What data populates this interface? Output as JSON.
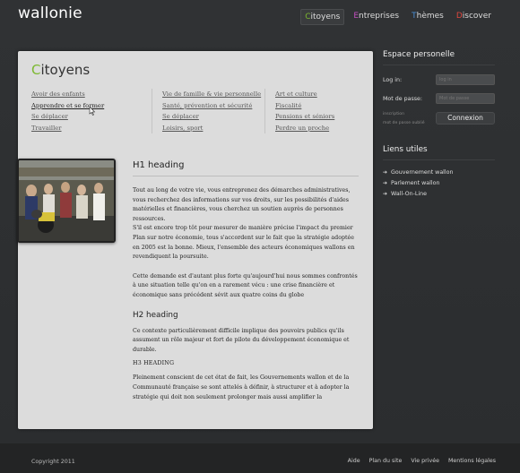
{
  "header": {
    "logo": "wallonie",
    "nav": [
      {
        "initial": "C",
        "rest": "itoyens",
        "color": "#7cb82f",
        "active": true
      },
      {
        "initial": "E",
        "rest": "ntreprises",
        "color": "#c24fc0",
        "active": false
      },
      {
        "initial": "T",
        "rest": "hèmes",
        "color": "#4a8fd6",
        "active": false
      },
      {
        "initial": "D",
        "rest": "iscover",
        "color": "#e0473f",
        "active": false
      }
    ]
  },
  "panel": {
    "title_first": "C",
    "title_rest": "itoyens",
    "links": {
      "col1": [
        "Avoir des enfants",
        "Apprendre et se former",
        "Se déplacer",
        "Travailler"
      ],
      "col2": [
        "Vie de famille & vie personnelle",
        "Santé, prévention et sécurité",
        "Se déplacer",
        "Loisirs, sport"
      ],
      "col3": [
        "Art et culture",
        "Fiscalité",
        "Pensions et séniors",
        "Perdre un proche"
      ]
    },
    "content": {
      "h1": "H1 heading",
      "p1": "Tout au long de votre vie, vous entreprenez des démarches administratives, vous recherchez des informations sur vos droits, sur les possibilités d'aides matérielles et financières, vous cherchez un soutien auprès de personnes ressources.",
      "p2": "S'il est encore trop tôt pour mesurer de manière précise l'impact du premier Plan sur notre économie, tous s'accordent sur le fait que la stratégie adoptée en 2005 est la bonne. Mieux, l'ensemble des acteurs économiques wallons en revendiquent la poursuite.",
      "p3": "Cette demande est d'autant plus forte qu'aujourd'hui nous sommes confrontés à une situation telle qu'on en a rarement vécu : une crise financière et économique sans précédent sévit aux quatre coins du globe",
      "h2": "H2 heading",
      "p4": "Ce contexte particulièrement difficile implique des pouvoirs publics qu'ils assument un rôle majeur et fort de pilote du développement économique et durable.",
      "h3": "H3 HEADING",
      "p5": "Pleinement conscient de cet état de fait, les Gouvernements wallon et de la Communauté française se sont attelés à définir, à structurer et à adopter la stratégie qui doit non seulement prolonger mais aussi amplifier la"
    }
  },
  "sidebar": {
    "espace_title": "Espace personelle",
    "login_label": "Log in:",
    "login_placeholder": "log in",
    "password_label": "Mot de passe:",
    "password_placeholder": "Mot de passe",
    "inscription": "inscription",
    "forgot": "mot de passe oublié",
    "connect_button": "Connexion",
    "liens_title": "Liens utiles",
    "liens": [
      "Gouvernement wallon",
      "Parlement wallon",
      "Wall-On-Line"
    ]
  },
  "footer": {
    "copyright": "Copyright 2011",
    "links": [
      "Aide",
      "Plan du site",
      "Vie privée",
      "Mentions légales"
    ]
  }
}
